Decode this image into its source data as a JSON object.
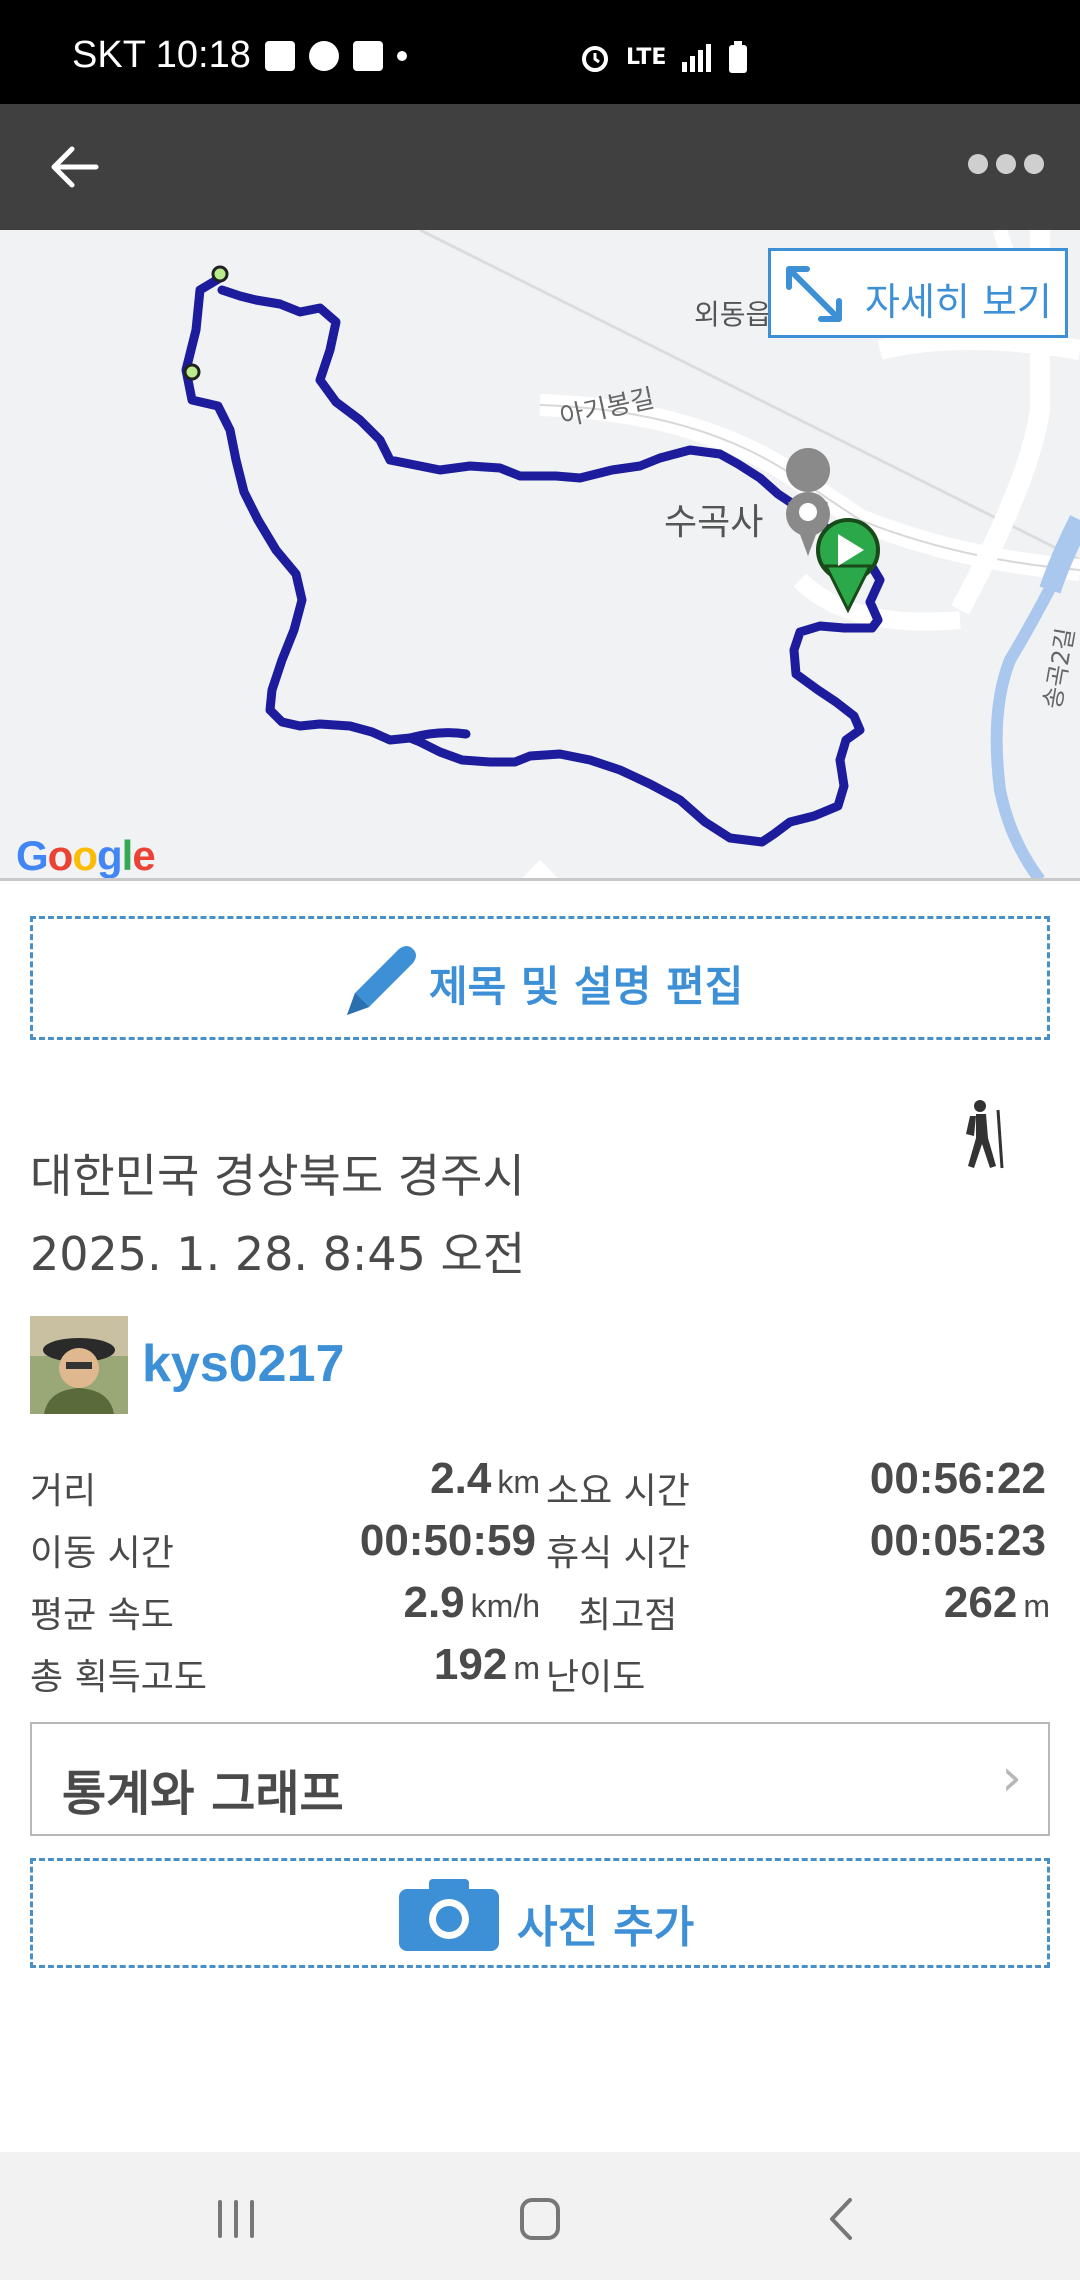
{
  "status_bar": {
    "carrier_time": "SKT 10:18",
    "network": "LTE"
  },
  "app_bar": {
    "back_icon": "arrow-left-icon",
    "more_icon": "more-dots-icon"
  },
  "map": {
    "detail_button_label": "자세히 보기",
    "labels": {
      "village": "외동읍",
      "road1": "아기봉길",
      "temple": "수곡사",
      "road2": "송곡2길"
    },
    "provider": "Google",
    "route_color": "#1c1c9c"
  },
  "edit": {
    "label": "제목 및 설명 편집"
  },
  "activity": {
    "location": "대한민국 경상북도 경주시",
    "datetime": "2025. 1. 28. 8:45 오전",
    "type_icon": "hiking-icon"
  },
  "user": {
    "name": "kys0217"
  },
  "stats": {
    "distance_label": "거리",
    "distance_value": "2.4",
    "distance_unit": "km",
    "duration_label": "소요 시간",
    "duration_value": "00:56:22",
    "moving_label": "이동 시간",
    "moving_value": "00:50:59",
    "rest_label": "휴식 시간",
    "rest_value": "00:05:23",
    "speed_label": "평균 속도",
    "speed_value": "2.9",
    "speed_unit": "km/h",
    "highest_label": "최고점",
    "highest_value": "262",
    "highest_unit": "m",
    "gain_label": "총 획득고도",
    "gain_value": "192",
    "gain_unit": "m",
    "difficulty_label": "난이도"
  },
  "stats_button": {
    "label": "통계와 그래프",
    "chevron": "›"
  },
  "photo": {
    "label": "사진 추가"
  },
  "colors": {
    "accent": "#3d8fd6",
    "appbar": "#404040",
    "text": "#4a4a4a"
  }
}
